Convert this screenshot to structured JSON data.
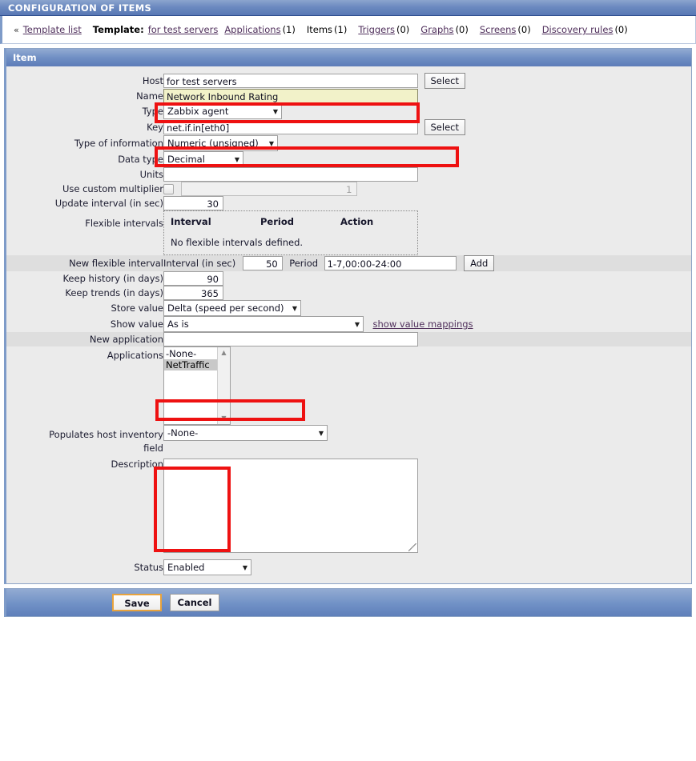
{
  "titlebar": {
    "title": "CONFIGURATION OF ITEMS"
  },
  "breadcrumb": {
    "chevron": "«",
    "template_list": "Template list",
    "template_label": "Template:",
    "template_name": "for test servers",
    "items": [
      {
        "label": "Applications",
        "count": "(1)",
        "link": true
      },
      {
        "label": "Items",
        "count": "(1)",
        "link": false
      },
      {
        "label": "Triggers",
        "count": "(0)",
        "link": true
      },
      {
        "label": "Graphs",
        "count": "(0)",
        "link": true
      },
      {
        "label": "Screens",
        "count": "(0)",
        "link": true
      },
      {
        "label": "Discovery rules",
        "count": "(0)",
        "link": true
      }
    ]
  },
  "panel": {
    "header": "Item"
  },
  "form": {
    "host": {
      "label": "Host",
      "value": "for test servers",
      "select_button": "Select"
    },
    "name": {
      "label": "Name",
      "value": "Network Inbound Rating"
    },
    "type": {
      "label": "Type",
      "value": "Zabbix agent"
    },
    "key": {
      "label": "Key",
      "value": "net.if.in[eth0]",
      "select_button": "Select"
    },
    "type_of_information": {
      "label": "Type of information",
      "value": "Numeric (unsigned)"
    },
    "data_type": {
      "label": "Data type",
      "value": "Decimal"
    },
    "units": {
      "label": "Units",
      "value": ""
    },
    "custom_multiplier": {
      "label": "Use custom multiplier",
      "value": "1",
      "checked": false
    },
    "update_interval": {
      "label": "Update interval (in sec)",
      "value": "30"
    },
    "flexible_intervals": {
      "label": "Flexible intervals",
      "columns": [
        "Interval",
        "Period",
        "Action"
      ],
      "empty_text": "No flexible intervals defined."
    },
    "new_flexible_interval": {
      "label": "New flexible interval",
      "interval_label": "Interval (in sec)",
      "interval_value": "50",
      "period_label": "Period",
      "period_value": "1-7,00:00-24:00",
      "add_button": "Add"
    },
    "keep_history": {
      "label": "Keep history (in days)",
      "value": "90"
    },
    "keep_trends": {
      "label": "Keep trends (in days)",
      "value": "365"
    },
    "store_value": {
      "label": "Store value",
      "value": "Delta (speed per second)"
    },
    "show_value": {
      "label": "Show value",
      "value": "As is",
      "link": "show value mappings"
    },
    "new_application": {
      "label": "New application",
      "value": ""
    },
    "applications": {
      "label": "Applications",
      "options": [
        {
          "text": "-None-",
          "selected": false
        },
        {
          "text": "NetTraffic",
          "selected": true
        }
      ]
    },
    "host_inventory": {
      "label_line1": "Populates host inventory",
      "label_line2": "field",
      "value": "-None-"
    },
    "description": {
      "label": "Description",
      "value": ""
    },
    "status": {
      "label": "Status",
      "value": "Enabled"
    }
  },
  "footer": {
    "save": "Save",
    "cancel": "Cancel"
  }
}
